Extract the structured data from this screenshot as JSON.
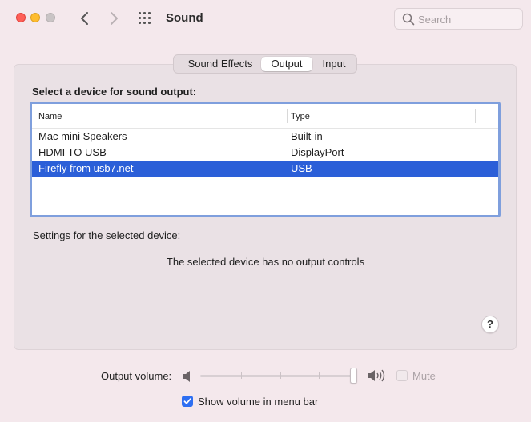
{
  "window": {
    "title": "Sound",
    "search_placeholder": "Search"
  },
  "tabs": [
    {
      "label": "Sound Effects",
      "selected": false
    },
    {
      "label": "Output",
      "selected": true
    },
    {
      "label": "Input",
      "selected": false
    }
  ],
  "output": {
    "select_label": "Select a device for sound output:",
    "columns": [
      "Name",
      "Type"
    ],
    "devices": [
      {
        "name": "Mac mini Speakers",
        "type": "Built-in",
        "selected": false
      },
      {
        "name": "HDMI TO USB",
        "type": "DisplayPort",
        "selected": false
      },
      {
        "name": "Firefly from usb7.net",
        "type": "USB",
        "selected": true
      }
    ],
    "settings_label": "Settings for the selected device:",
    "no_controls_text": "The selected device has no output controls",
    "help_label": "?"
  },
  "volume": {
    "label": "Output volume:",
    "level": 1.0,
    "mute_label": "Mute",
    "mute_checked": false,
    "mute_enabled": false
  },
  "menu_bar": {
    "show_volume_label": "Show volume in menu bar",
    "checked": true
  },
  "colors": {
    "selection": "#2b5fd8",
    "focus_ring": "#7f9fdd",
    "checkbox_accent": "#2e6ff2"
  }
}
